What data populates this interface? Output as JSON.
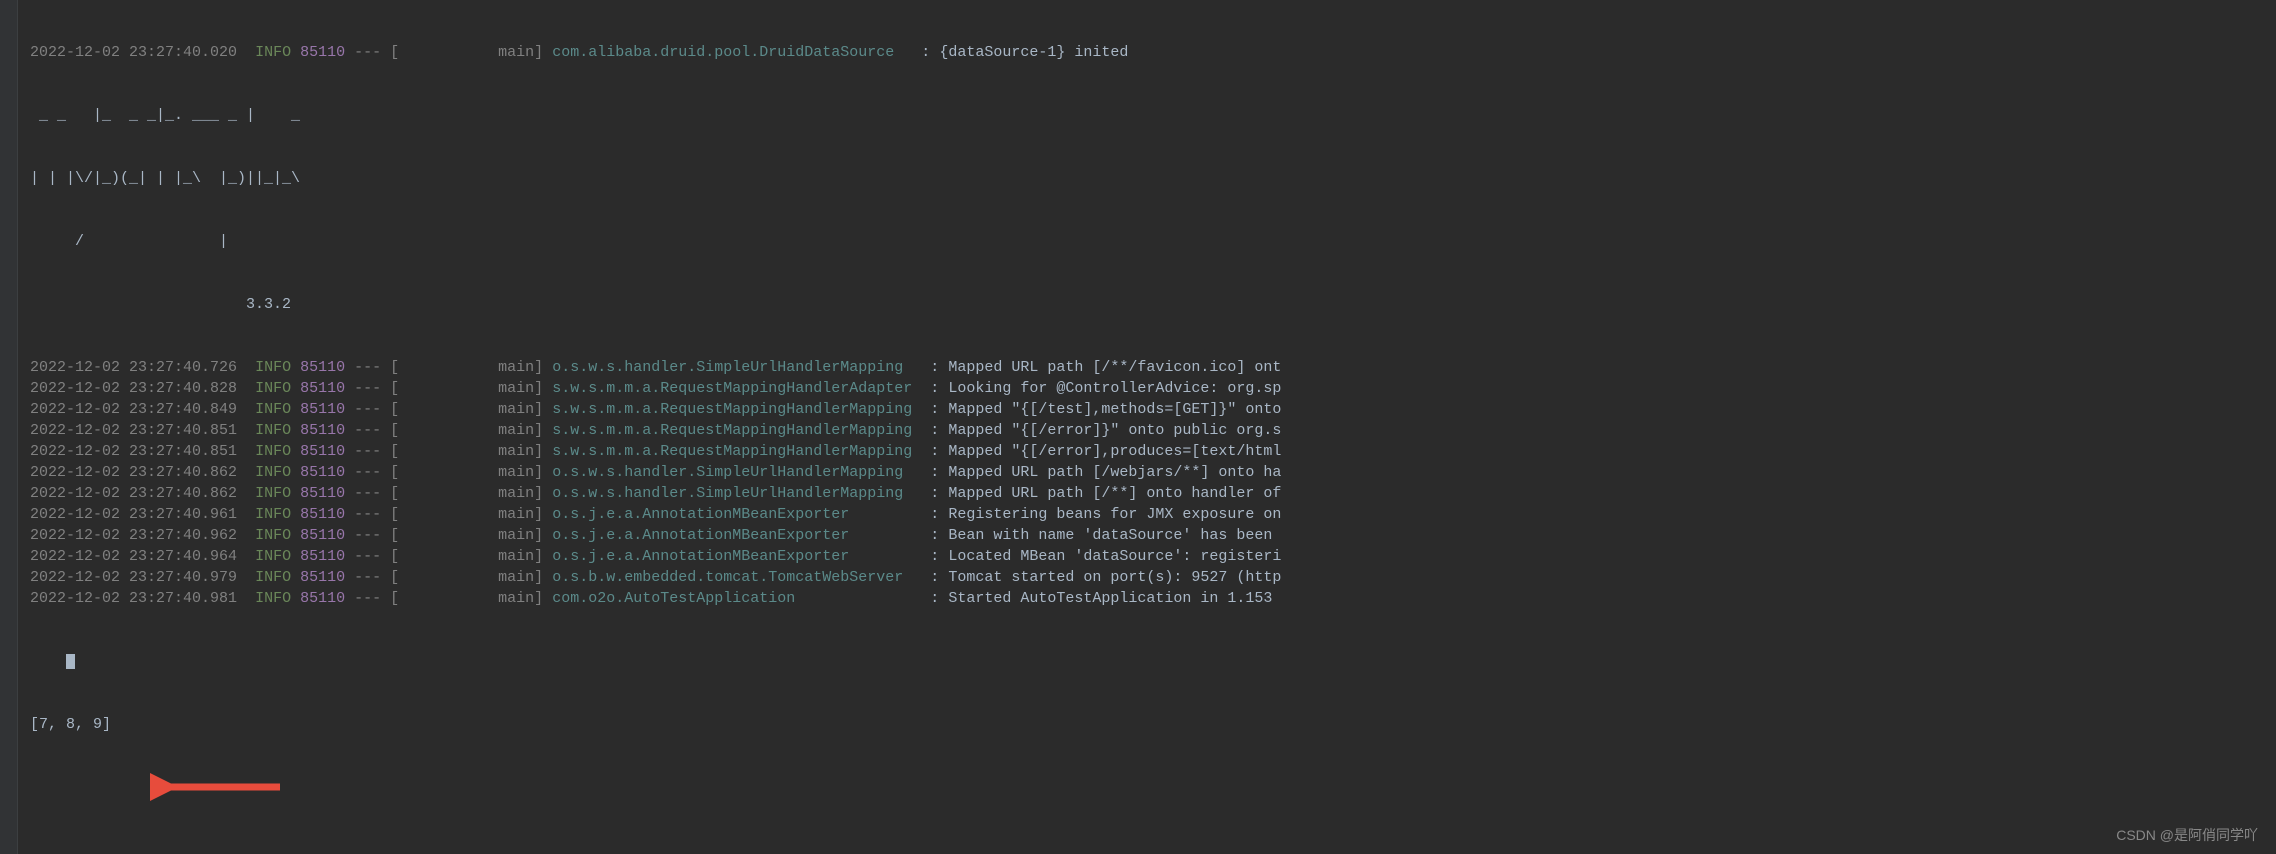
{
  "topLine": {
    "ts": "2022-12-02 23:27:40.020",
    "level": "INFO",
    "pid": "85110",
    "sep": "---",
    "thread": "[           main]",
    "cls": "com.alibaba.druid.pool.DruidDataSource",
    "colon": ":",
    "msg": "{dataSource-1} inited"
  },
  "ascii": {
    "l1": " _ _   |_  _ _|_. ___ _ |    _",
    "l2": "| | |\\/|_)(_| | |_\\  |_)||_|_\\",
    "l3": "     /               |"
  },
  "version": "                        3.3.2",
  "logLines": [
    {
      "ts": "2022-12-02 23:27:40.726",
      "level": "INFO",
      "pid": "85110",
      "sep": "---",
      "thread": "[           main]",
      "cls": "o.s.w.s.handler.SimpleUrlHandlerMapping  ",
      "msg": "Mapped URL path [/**/favicon.ico] ont"
    },
    {
      "ts": "2022-12-02 23:27:40.828",
      "level": "INFO",
      "pid": "85110",
      "sep": "---",
      "thread": "[           main]",
      "cls": "s.w.s.m.m.a.RequestMappingHandlerAdapter ",
      "msg": "Looking for @ControllerAdvice: org.sp"
    },
    {
      "ts": "2022-12-02 23:27:40.849",
      "level": "INFO",
      "pid": "85110",
      "sep": "---",
      "thread": "[           main]",
      "cls": "s.w.s.m.m.a.RequestMappingHandlerMapping ",
      "msg": "Mapped \"{[/test],methods=[GET]}\" onto"
    },
    {
      "ts": "2022-12-02 23:27:40.851",
      "level": "INFO",
      "pid": "85110",
      "sep": "---",
      "thread": "[           main]",
      "cls": "s.w.s.m.m.a.RequestMappingHandlerMapping ",
      "msg": "Mapped \"{[/error]}\" onto public org.s"
    },
    {
      "ts": "2022-12-02 23:27:40.851",
      "level": "INFO",
      "pid": "85110",
      "sep": "---",
      "thread": "[           main]",
      "cls": "s.w.s.m.m.a.RequestMappingHandlerMapping ",
      "msg": "Mapped \"{[/error],produces=[text/html"
    },
    {
      "ts": "2022-12-02 23:27:40.862",
      "level": "INFO",
      "pid": "85110",
      "sep": "---",
      "thread": "[           main]",
      "cls": "o.s.w.s.handler.SimpleUrlHandlerMapping  ",
      "msg": "Mapped URL path [/webjars/**] onto ha"
    },
    {
      "ts": "2022-12-02 23:27:40.862",
      "level": "INFO",
      "pid": "85110",
      "sep": "---",
      "thread": "[           main]",
      "cls": "o.s.w.s.handler.SimpleUrlHandlerMapping  ",
      "msg": "Mapped URL path [/**] onto handler of"
    },
    {
      "ts": "2022-12-02 23:27:40.961",
      "level": "INFO",
      "pid": "85110",
      "sep": "---",
      "thread": "[           main]",
      "cls": "o.s.j.e.a.AnnotationMBeanExporter        ",
      "msg": "Registering beans for JMX exposure on"
    },
    {
      "ts": "2022-12-02 23:27:40.962",
      "level": "INFO",
      "pid": "85110",
      "sep": "---",
      "thread": "[           main]",
      "cls": "o.s.j.e.a.AnnotationMBeanExporter        ",
      "msg": "Bean with name 'dataSource' has been "
    },
    {
      "ts": "2022-12-02 23:27:40.964",
      "level": "INFO",
      "pid": "85110",
      "sep": "---",
      "thread": "[           main]",
      "cls": "o.s.j.e.a.AnnotationMBeanExporter        ",
      "msg": "Located MBean 'dataSource': registeri"
    },
    {
      "ts": "2022-12-02 23:27:40.979",
      "level": "INFO",
      "pid": "85110",
      "sep": "---",
      "thread": "[           main]",
      "cls": "o.s.b.w.embedded.tomcat.TomcatWebServer  ",
      "msg": "Tomcat started on port(s): 9527 (http"
    },
    {
      "ts": "2022-12-02 23:27:40.981",
      "level": "INFO",
      "pid": "85110",
      "sep": "---",
      "thread": "[           main]",
      "cls": "com.o2o.AutoTestApplication              ",
      "msg": "Started AutoTestApplication in 1.153 "
    }
  ],
  "output": "[7, 8, 9]",
  "watermark": "CSDN @是阿俏同学吖"
}
